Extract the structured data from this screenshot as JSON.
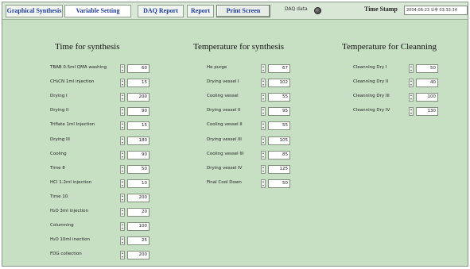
{
  "tabs": [
    {
      "label": "Graphical Synthesis"
    },
    {
      "label": "Variable Setting"
    },
    {
      "label": "DAQ Report"
    },
    {
      "label": "Report"
    }
  ],
  "toolbar": {
    "print_label": "Print Screen",
    "daq_label": "DAQ data",
    "timestamp_label": "Time Stamp",
    "timestamp_value": "2004-06-23 오후 03:33:34"
  },
  "sections": {
    "time": {
      "title": "Time for synthesis",
      "rows": [
        {
          "label": "TBAB 0.5ml  QMA washing",
          "value": "60"
        },
        {
          "label": "CH₃CN 1ml injection",
          "value": "15"
        },
        {
          "label": "Drying I",
          "value": "200"
        },
        {
          "label": "Drying II",
          "value": "90"
        },
        {
          "label": "Triflate 1ml  Injection",
          "value": "15"
        },
        {
          "label": "Drying III",
          "value": "180"
        },
        {
          "label": "Cooling",
          "value": "90"
        },
        {
          "label": "Time 8",
          "value": "50"
        },
        {
          "label": "HCl 1.2ml injection",
          "value": "10"
        },
        {
          "label": "Time 10",
          "value": "200"
        },
        {
          "label": "H₂O 3ml injection",
          "value": "20"
        },
        {
          "label": "Columning",
          "value": "100"
        },
        {
          "label": "H₂O 10ml inection",
          "value": "25"
        },
        {
          "label": "FDG collection",
          "value": "200"
        }
      ]
    },
    "temperature": {
      "title": "Temperature for synthesis",
      "rows": [
        {
          "label": "He purge",
          "value": "67"
        },
        {
          "label": "Drying vessel I",
          "value": "102"
        },
        {
          "label": "Cooling vessel",
          "value": "55"
        },
        {
          "label": "Drying vessel II",
          "value": "95"
        },
        {
          "label": "Cooling vessel II",
          "value": "55"
        },
        {
          "label": "Drying vessel III",
          "value": "105"
        },
        {
          "label": "Cooling vessel III",
          "value": "85"
        },
        {
          "label": "Drying vessel IV",
          "value": "125"
        },
        {
          "label": "Final Cool Down",
          "value": "50"
        }
      ]
    },
    "cleaning": {
      "title": "Temperature for Cleanning",
      "rows": [
        {
          "label": "Cleanning Dry I",
          "value": "50"
        },
        {
          "label": "Cleanning Dry II",
          "value": "40"
        },
        {
          "label": "Cleanning Dry III",
          "value": "100"
        },
        {
          "label": "Cleanning Dry IV",
          "value": "130"
        }
      ]
    }
  },
  "colors": {
    "panel_background": "#c7e0c4",
    "tab_text": "#1f3aa0"
  }
}
